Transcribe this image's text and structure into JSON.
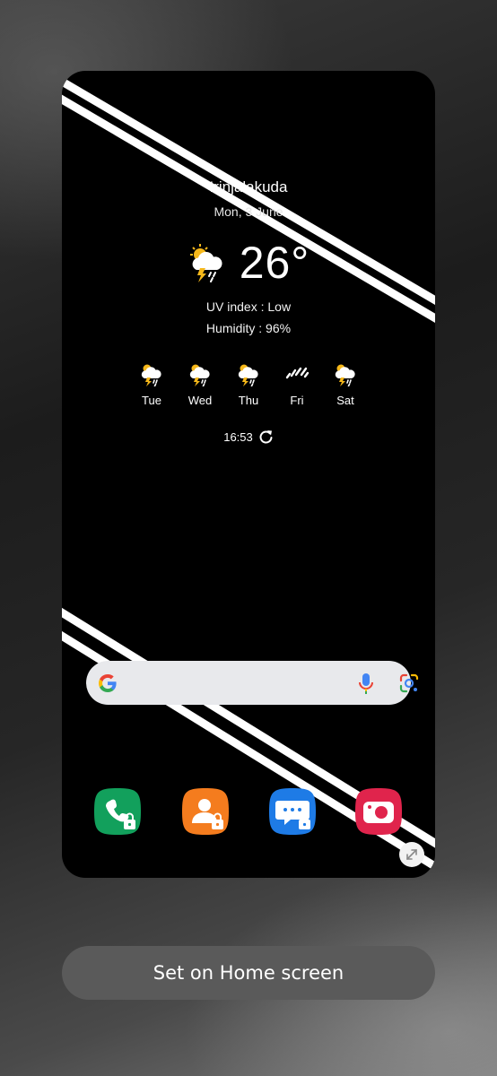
{
  "weather": {
    "city": "Irinjalakuda",
    "date": "Mon, 3 June",
    "temperature": "26°",
    "uv_index": "UV index : Low",
    "humidity": "Humidity : 96%",
    "forecast": [
      {
        "day": "Tue",
        "icon": "thunder-rain-icon"
      },
      {
        "day": "Wed",
        "icon": "thunder-rain-icon"
      },
      {
        "day": "Thu",
        "icon": "thunder-rain-icon"
      },
      {
        "day": "Fri",
        "icon": "rain-icon"
      },
      {
        "day": "Sat",
        "icon": "thunder-rain-icon"
      }
    ],
    "updated_time": "16:53"
  },
  "dock": [
    {
      "app": "Phone",
      "color": "#12a05c",
      "locked": true
    },
    {
      "app": "Contacts",
      "color": "#f47c1e",
      "locked": true
    },
    {
      "app": "Messages",
      "color": "#1e7be6",
      "locked": true
    },
    {
      "app": "Camera",
      "color": "#e0244c",
      "locked": false
    }
  ],
  "actions": {
    "set_home_label": "Set on Home screen"
  },
  "colors": {
    "sun": "#f6b81a",
    "bolt": "#f6b81a",
    "cloud": "#ffffff",
    "search_bar": "#e8e9ec",
    "button_bg": "#5a5a5a"
  }
}
